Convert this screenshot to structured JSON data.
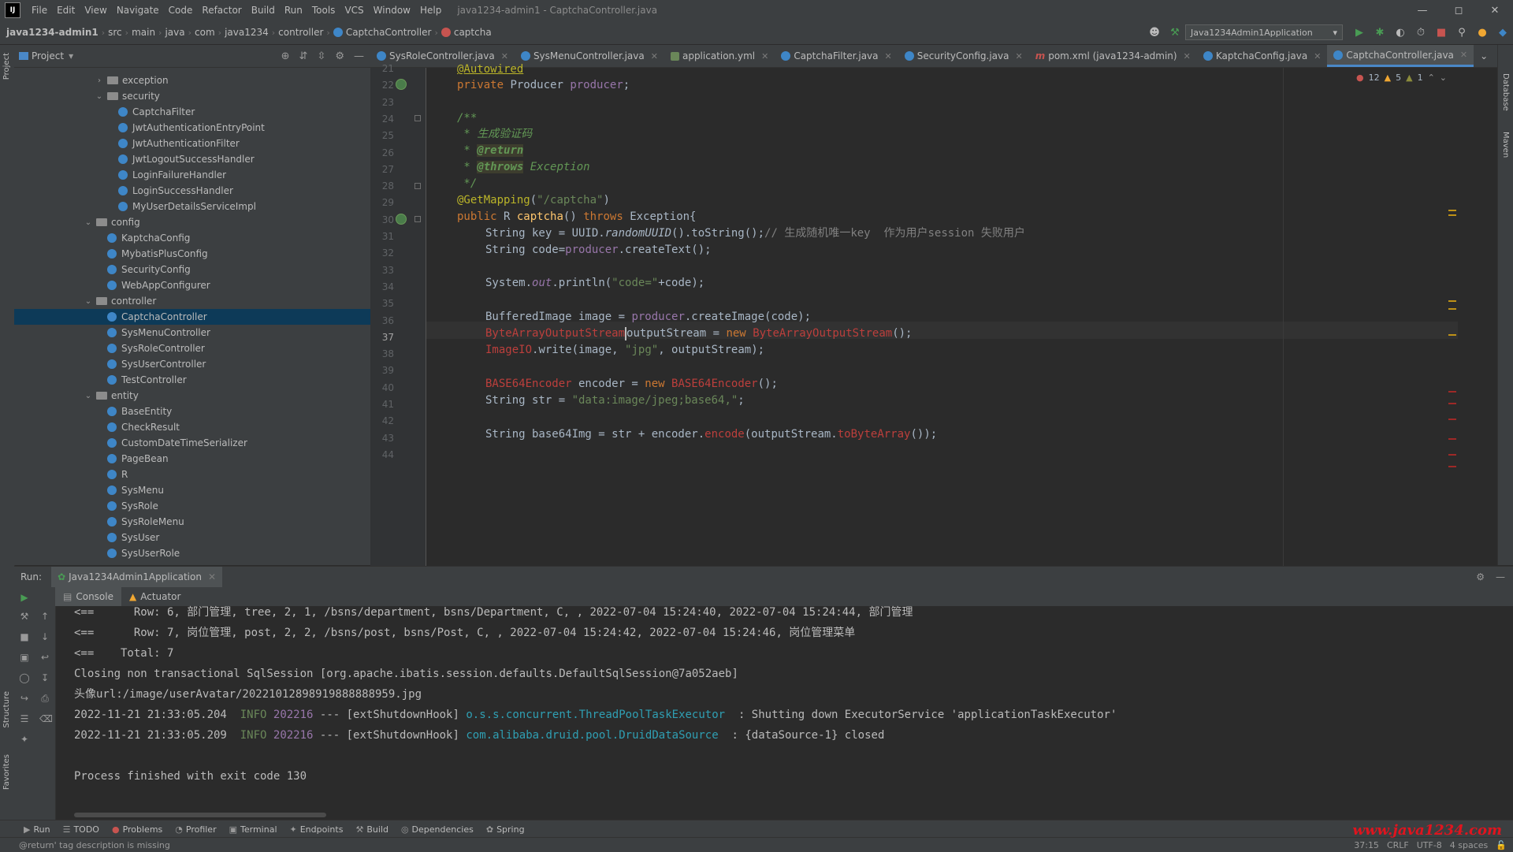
{
  "menubar": {
    "items": [
      "File",
      "Edit",
      "View",
      "Navigate",
      "Code",
      "Refactor",
      "Build",
      "Run",
      "Tools",
      "VCS",
      "Window",
      "Help"
    ],
    "window_title": "java1234-admin1 - CaptchaController.java"
  },
  "navbar": {
    "crumbs": [
      "java1234-admin1",
      "src",
      "main",
      "java",
      "com",
      "java1234",
      "controller",
      "CaptchaController",
      "captcha"
    ],
    "run_config": "Java1234Admin1Application"
  },
  "project": {
    "title": "Project",
    "tree": [
      {
        "label": "exception",
        "type": "folder",
        "level": 1,
        "expanded": false
      },
      {
        "label": "security",
        "type": "folder",
        "level": 1,
        "expanded": true
      },
      {
        "label": "CaptchaFilter",
        "type": "class",
        "level": 2
      },
      {
        "label": "JwtAuthenticationEntryPoint",
        "type": "class",
        "level": 2
      },
      {
        "label": "JwtAuthenticationFilter",
        "type": "class",
        "level": 2
      },
      {
        "label": "JwtLogoutSuccessHandler",
        "type": "class",
        "level": 2
      },
      {
        "label": "LoginFailureHandler",
        "type": "class",
        "level": 2
      },
      {
        "label": "LoginSuccessHandler",
        "type": "class",
        "level": 2
      },
      {
        "label": "MyUserDetailsServiceImpl",
        "type": "class",
        "level": 2
      },
      {
        "label": "config",
        "type": "folder",
        "level": 0,
        "expanded": true
      },
      {
        "label": "KaptchaConfig",
        "type": "class",
        "level": 1
      },
      {
        "label": "MybatisPlusConfig",
        "type": "class",
        "level": 1
      },
      {
        "label": "SecurityConfig",
        "type": "class",
        "level": 1
      },
      {
        "label": "WebAppConfigurer",
        "type": "class",
        "level": 1
      },
      {
        "label": "controller",
        "type": "folder",
        "level": 0,
        "expanded": true
      },
      {
        "label": "CaptchaController",
        "type": "class",
        "level": 1,
        "selected": true
      },
      {
        "label": "SysMenuController",
        "type": "class",
        "level": 1
      },
      {
        "label": "SysRoleController",
        "type": "class",
        "level": 1
      },
      {
        "label": "SysUserController",
        "type": "class",
        "level": 1
      },
      {
        "label": "TestController",
        "type": "class",
        "level": 1
      },
      {
        "label": "entity",
        "type": "folder",
        "level": 0,
        "expanded": true
      },
      {
        "label": "BaseEntity",
        "type": "class",
        "level": 1
      },
      {
        "label": "CheckResult",
        "type": "class",
        "level": 1
      },
      {
        "label": "CustomDateTimeSerializer",
        "type": "class",
        "level": 1
      },
      {
        "label": "PageBean",
        "type": "class",
        "level": 1
      },
      {
        "label": "R",
        "type": "class",
        "level": 1
      },
      {
        "label": "SysMenu",
        "type": "class",
        "level": 1
      },
      {
        "label": "SysRole",
        "type": "class",
        "level": 1
      },
      {
        "label": "SysRoleMenu",
        "type": "class",
        "level": 1
      },
      {
        "label": "SysUser",
        "type": "class",
        "level": 1
      },
      {
        "label": "SysUserRole",
        "type": "class",
        "level": 1
      }
    ]
  },
  "tabs": [
    {
      "label": "SysRoleController.java",
      "icon": "class"
    },
    {
      "label": "SysMenuController.java",
      "icon": "class"
    },
    {
      "label": "application.yml",
      "icon": "yaml"
    },
    {
      "label": "CaptchaFilter.java",
      "icon": "class"
    },
    {
      "label": "SecurityConfig.java",
      "icon": "class"
    },
    {
      "label": "pom.xml (java1234-admin)",
      "icon": "maven"
    },
    {
      "label": "KaptchaConfig.java",
      "icon": "class"
    },
    {
      "label": "CaptchaController.java",
      "icon": "class",
      "active": true
    }
  ],
  "editor": {
    "line_numbers": [
      "21",
      "22",
      "23",
      "24",
      "25",
      "26",
      "27",
      "28",
      "29",
      "30",
      "31",
      "32",
      "33",
      "34",
      "35",
      "36",
      "37",
      "38",
      "39",
      "40",
      "41",
      "42",
      "43",
      "44"
    ],
    "current_line": "37",
    "inspections": {
      "errors": "12",
      "warnings": "5",
      "weak": "1"
    }
  },
  "run": {
    "label": "Run:",
    "tab": "Java1234Admin1Application",
    "subtabs": [
      "Console",
      "Actuator"
    ],
    "console": [
      "<==      Row: 6, 部门管理, tree, 2, 1, /bsns/department, bsns/Department, C, , 2022-07-04 15:24:40, 2022-07-04 15:24:44, 部门管理",
      "<==      Row: 7, 岗位管理, post, 2, 2, /bsns/post, bsns/Post, C, , 2022-07-04 15:24:42, 2022-07-04 15:24:46, 岗位管理菜单",
      "<==    Total: 7",
      "Closing non transactional SqlSession [org.apache.ibatis.session.defaults.DefaultSqlSession@7a052aeb]",
      "头像url:/image/userAvatar/20221012898919888888959.jpg"
    ],
    "log1": {
      "time": "2022-11-21 21:33:05.204",
      "level": "INFO",
      "pid": "202216",
      "thread": "--- [extShutdownHook]",
      "logger": "o.s.s.concurrent.ThreadPoolTaskExecutor",
      "msg": "  : Shutting down ExecutorService 'applicationTaskExecutor'"
    },
    "log2": {
      "time": "2022-11-21 21:33:05.209",
      "level": "INFO",
      "pid": "202216",
      "thread": "--- [extShutdownHook]",
      "logger": "com.alibaba.druid.pool.DruidDataSource",
      "msg": "  : {dataSource-1} closed"
    },
    "exit": "Process finished with exit code 130"
  },
  "bottom_tools": [
    {
      "label": "Run",
      "icon": "run"
    },
    {
      "label": "TODO",
      "icon": "todo"
    },
    {
      "label": "Problems",
      "icon": "problems"
    },
    {
      "label": "Profiler",
      "icon": "profiler"
    },
    {
      "label": "Terminal",
      "icon": "terminal"
    },
    {
      "label": "Endpoints",
      "icon": "endpoints"
    },
    {
      "label": "Build",
      "icon": "build"
    },
    {
      "label": "Dependencies",
      "icon": "dependencies"
    },
    {
      "label": "Spring",
      "icon": "spring"
    }
  ],
  "status": {
    "message": "@return' tag description is missing",
    "position": "37:15",
    "line_sep": "CRLF",
    "encoding": "UTF-8",
    "indent": "4 spaces"
  },
  "watermark": "www.java1234.com",
  "side_labels": {
    "left_top": "Project",
    "left_bottom1": "Structure",
    "left_bottom2": "Favorites",
    "right1": "Database",
    "right2": "Maven"
  }
}
